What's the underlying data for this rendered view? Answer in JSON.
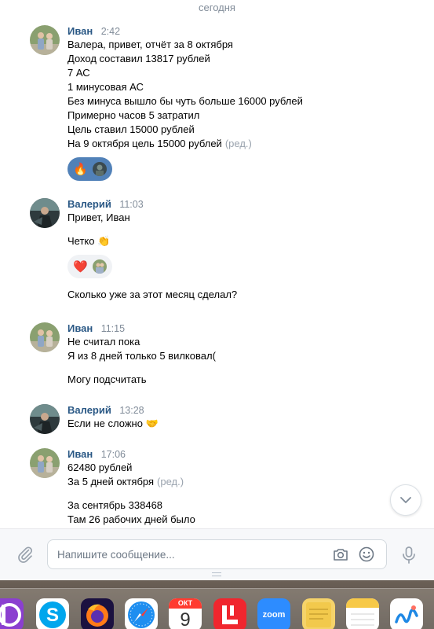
{
  "chat": {
    "date_separator": "сегодня",
    "messages": [
      {
        "author": "Иван",
        "time": "2:42",
        "lines": [
          "Валера, привет, отчёт за 8 октября",
          "Доход составил 13817 рублей",
          "7 АС",
          "1 минусовая АС",
          "Без минуса вышло бы чуть больше 16000 рублей",
          "Примерно часов 5 затратил",
          "Цель ставил 15000 рублей",
          "На 9 октября цель 15000 рублей"
        ],
        "edited_label": "(ред.)",
        "reactions": [
          "🔥"
        ]
      },
      {
        "author": "Валерий",
        "time": "11:03",
        "line1": "Привет, Иван",
        "line2": "Четко 👏",
        "reactions": [
          "❤️"
        ],
        "line3": "Сколько уже за этот месяц сделал?"
      },
      {
        "author": "Иван",
        "time": "11:15",
        "line1": "Не считал пока",
        "line2": "Я из 8 дней только 5 вилковал(",
        "line3": "Могу подсчитать"
      },
      {
        "author": "Валерий",
        "time": "13:28",
        "line1": "Если не сложно 🤝"
      },
      {
        "author": "Иван",
        "time": "17:06",
        "line1": "62480 рублей",
        "line2": "За 5 дней октября",
        "edited_label": "(ред.)",
        "line3": "За сентябрь 338468",
        "line4": "Там 26 рабочих дней было"
      }
    ]
  },
  "composer": {
    "placeholder": "Напишите сообщение..."
  },
  "dock": {
    "calendar_month": "ОКТ",
    "calendar_day": "9",
    "zoom_label": "zoom"
  },
  "colors": {
    "author": "#2a5885",
    "accent": "#5181b8",
    "muted": "#818c99"
  }
}
